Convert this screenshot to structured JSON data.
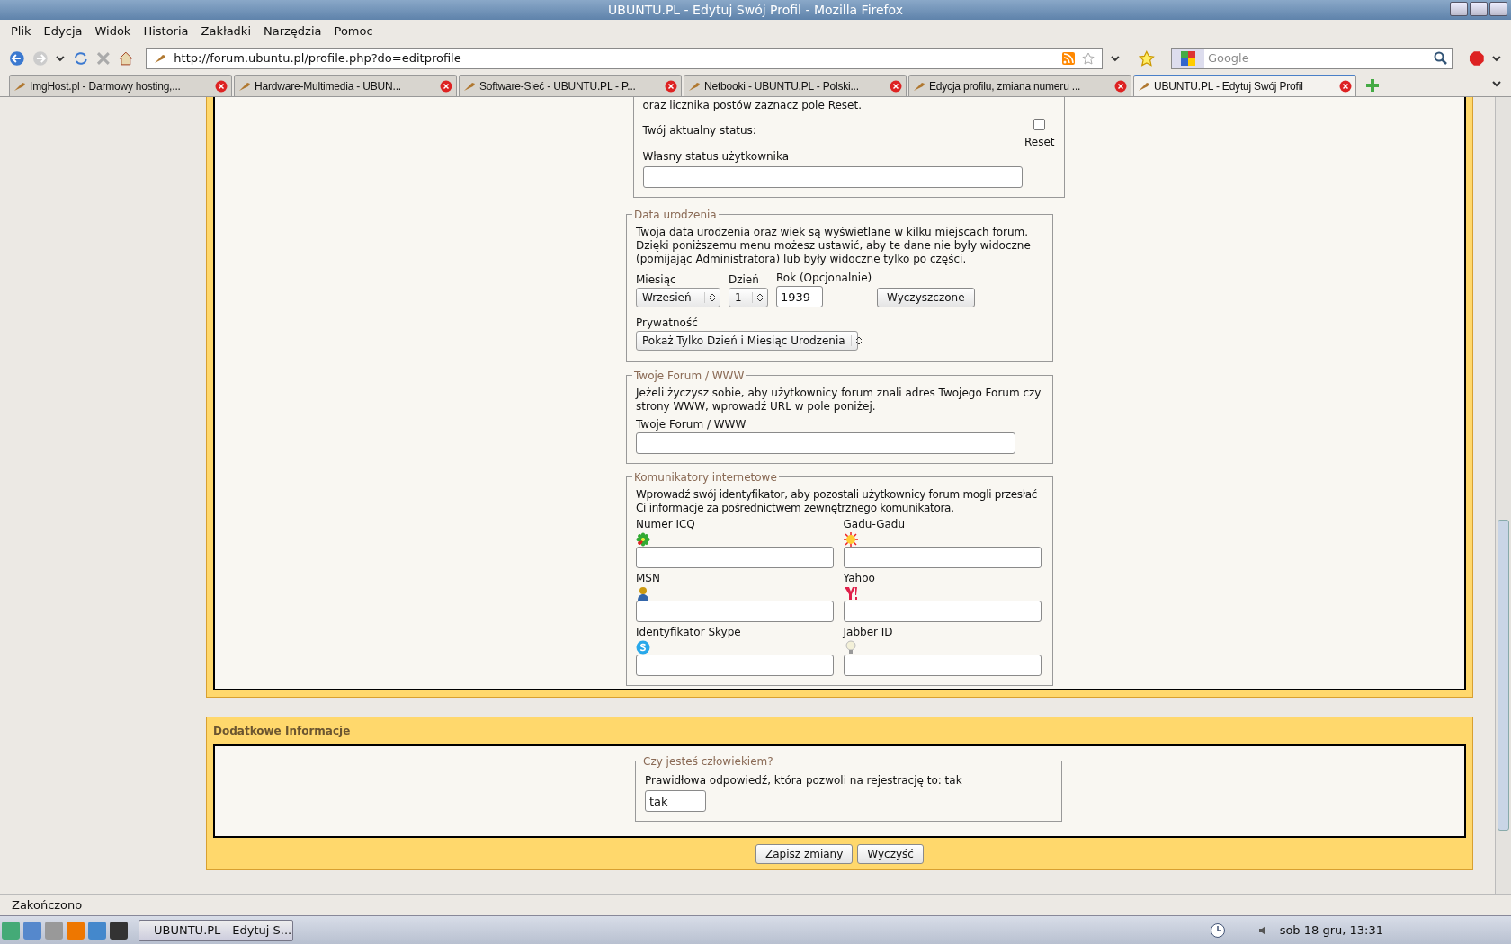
{
  "window": {
    "title": "UBUNTU.PL - Edytuj Swój Profil - Mozilla Firefox"
  },
  "menu": [
    "Plik",
    "Edycja",
    "Widok",
    "Historia",
    "Zakładki",
    "Narzędzia",
    "Pomoc"
  ],
  "address": {
    "value": "http://forum.ubuntu.pl/profile.php?do=editprofile"
  },
  "search": {
    "placeholder": "Google"
  },
  "tabs": [
    {
      "label": "ImgHost.pl - Darmowy hosting,...",
      "selected": false
    },
    {
      "label": "Hardware-Multimedia - UBUN...",
      "selected": false
    },
    {
      "label": "Software-Sieć - UBUNTU.PL - P...",
      "selected": false
    },
    {
      "label": "Netbooki - UBUNTU.PL - Polski...",
      "selected": false
    },
    {
      "label": "Edycja profilu, zmiana numeru ...",
      "selected": false
    },
    {
      "label": "UBUNTU.PL - Edytuj Swój Profil",
      "selected": true
    }
  ],
  "status_section": {
    "intro": "oraz licznika postów zaznacz pole Reset.",
    "current_label": "Twój aktualny status:",
    "reset": {
      "label": "Reset",
      "checked": false
    },
    "custom_label": "Własny status użytkownika"
  },
  "birthday": {
    "legend": "Data urodzenia",
    "text": "Twoja data urodzenia oraz wiek są wyświetlane w kilku miejscach forum. Dzięki poniższemu menu możesz ustawić, aby te dane nie były widoczne (pomijając Administratora) lub były widoczne tylko po części.",
    "month_label": "Miesiąc",
    "month": "Wrzesień",
    "day_label": "Dzień",
    "day": "1",
    "year_label": "Rok (Opcjonalnie)",
    "year": "1939",
    "clear_button": "Wyczyszczone",
    "privacy_label": "Prywatność",
    "privacy": "Pokaż Tylko Dzień i Miesiąc Urodzenia"
  },
  "website": {
    "legend": "Twoje Forum / WWW",
    "text": "Jeżeli życzysz sobie, aby użytkownicy forum znali adres Twojego Forum czy strony WWW, wprowadź URL w pole poniżej.",
    "field_label": "Twoje Forum / WWW"
  },
  "messengers": {
    "legend": "Komunikatory internetowe",
    "text": "Wprowadź swój identyfikator, aby pozostali użytkownicy forum mogli przesłać Ci informacje za pośrednictwem zewnętrznego komunikatora.",
    "fields": [
      {
        "label": "Numer ICQ",
        "kind": "flower"
      },
      {
        "label": "Gadu-Gadu",
        "kind": "sun"
      },
      {
        "label": "MSN",
        "kind": "person"
      },
      {
        "label": "Yahoo",
        "kind": "yahoo"
      },
      {
        "label": "Identyfikator Skype",
        "kind": "skype"
      },
      {
        "label": "Jabber ID",
        "kind": "bulb"
      }
    ]
  },
  "extra": {
    "title": "Dodatkowe Informacje",
    "legend": "Czy jesteś człowiekiem?",
    "question": "Prawidłowa odpowiedź, która pozwoli na rejestrację to: tak",
    "answer": "tak"
  },
  "buttons": [
    "Zapisz zmiany",
    "Wyczyść"
  ],
  "status_bar": "Zakończono",
  "taskbar": {
    "window": "UBUNTU.PL - Edytuj S...",
    "clock": "sob 18 gru, 13:31"
  }
}
